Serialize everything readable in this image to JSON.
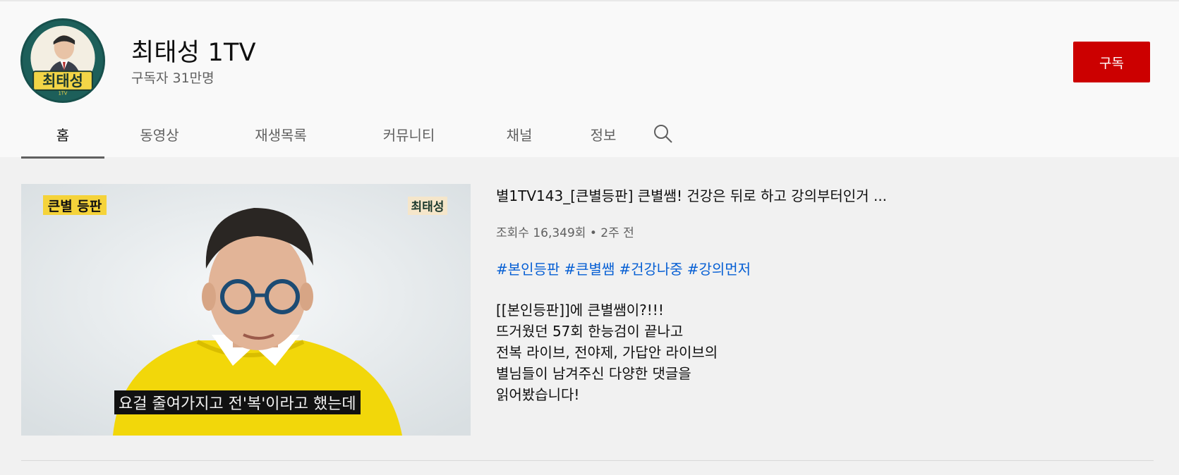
{
  "channel": {
    "name": "최태성 1TV",
    "subscribers": "구독자 31만명",
    "subscribe_label": "구독",
    "avatar_text": "최태성",
    "avatar_subtext": "1TV"
  },
  "tabs": [
    {
      "label": "홈",
      "active": true
    },
    {
      "label": "동영상"
    },
    {
      "label": "재생목록"
    },
    {
      "label": "커뮤니티"
    },
    {
      "label": "채널"
    },
    {
      "label": "정보"
    }
  ],
  "featured_video": {
    "thumbnail": {
      "badge_left": "큰별 등판",
      "badge_right": "최태성",
      "caption": "요걸 줄여가지고 전'복'이라고 했는데"
    },
    "title": "별1TV143_[큰별등판] 큰별쌤! 건강은 뒤로 하고 강의부터인거 ...",
    "meta": "조회수 16,349회 • 2주 전",
    "hashtags": [
      "#본인등판",
      "#큰별쌤",
      "#건강나중",
      "#강의먼저"
    ],
    "description": [
      "[[본인등판]]에 큰별쌤이?!!!",
      "뜨거웠던 57회 한능검이 끝나고",
      "전복 라이브, 전야제, 가답안 라이브의",
      "별님들이 남겨주신 다양한 댓글을",
      "읽어봤습니다!"
    ]
  },
  "colors": {
    "subscribe": "#cc0000",
    "hashtag": "#065fd4",
    "thumbnail_badge": "#f5d33a"
  }
}
